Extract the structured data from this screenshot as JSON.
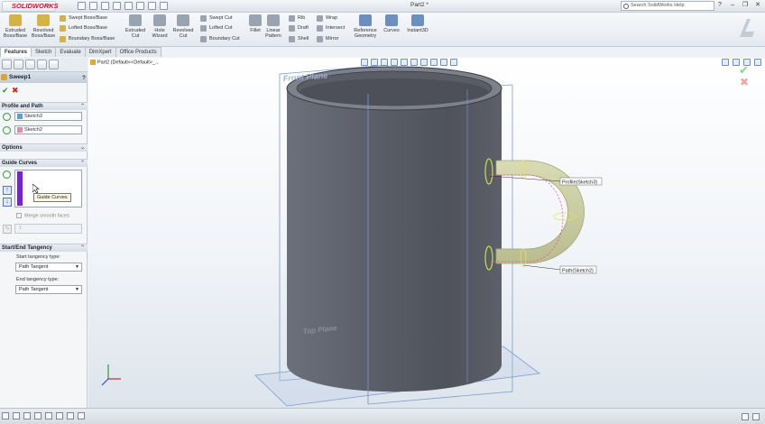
{
  "app": {
    "logo_text": "SOLIDWORKS",
    "doc_title": "Part2 *",
    "help_search_placeholder": "Search SolidWorks Help"
  },
  "ribbon": {
    "big_buttons": [
      {
        "label": "Extruded Boss/Base",
        "line1": "Extruded",
        "line2": "Boss/Base"
      },
      {
        "label": "Revolved Boss/Base",
        "line1": "Revolved",
        "line2": "Boss/Base"
      },
      {
        "label": "Extruded Cut",
        "line1": "Extruded",
        "line2": "Cut"
      },
      {
        "label": "Hole Wizard",
        "line1": "Hole",
        "line2": "Wizard"
      },
      {
        "label": "Revolved Cut",
        "line1": "Revolved",
        "line2": "Cut"
      },
      {
        "label": "Fillet",
        "line1": "Fillet",
        "line2": ""
      },
      {
        "label": "Linear Pattern",
        "line1": "Linear",
        "line2": "Pattern"
      },
      {
        "label": "Reference Geometry",
        "line1": "Reference",
        "line2": "Geometry"
      },
      {
        "label": "Curves",
        "line1": "Curves",
        "line2": ""
      },
      {
        "label": "Instant3D",
        "line1": "Instant3D",
        "line2": ""
      }
    ],
    "swept_boss": "Swept Boss/Base",
    "lofted_boss": "Lofted Boss/Base",
    "boundary_boss": "Boundary Boss/Base",
    "swept_cut": "Swept Cut",
    "lofted_cut": "Lofted Cut",
    "boundary_cut": "Boundary Cut",
    "rib": "Rib",
    "draft": "Draft",
    "shell": "Shell",
    "wrap": "Wrap",
    "intersect": "Intersect",
    "mirror": "Mirror"
  },
  "tabs": [
    "Features",
    "Sketch",
    "Evaluate",
    "DimXpert",
    "Office Products"
  ],
  "property_manager": {
    "title": "Sweep1",
    "help": "?",
    "sections": {
      "profile_path": "Profile and Path",
      "options": "Options",
      "guide_curves": "Guide Curves",
      "tangency": "Start/End Tangency"
    },
    "profile_value": "Sketch3",
    "path_value": "Sketch2",
    "guide_tooltip": "Guide Curves",
    "merge_label": "Merge smooth faces",
    "spin_value": "1",
    "start_tangency_label": "Start tangency type:",
    "start_tangency_value": "Path Tangent",
    "end_tangency_label": "End tangency type:",
    "end_tangency_value": "Path Tangent"
  },
  "viewport": {
    "tree_root": "Part2  (Default<<Default>_...",
    "front_plane": "Front Plane",
    "top_plane": "Top Plane",
    "profile_callout": "Profile(Sketch3)",
    "path_callout": "Path(Sketch2)"
  },
  "colors": {
    "profile_swatch": "#5aa0e0",
    "path_swatch": "#e88ab0",
    "guide_bar": "#7b1ee0",
    "mug_body": "#62656f",
    "handle": "#cfd2a2"
  }
}
